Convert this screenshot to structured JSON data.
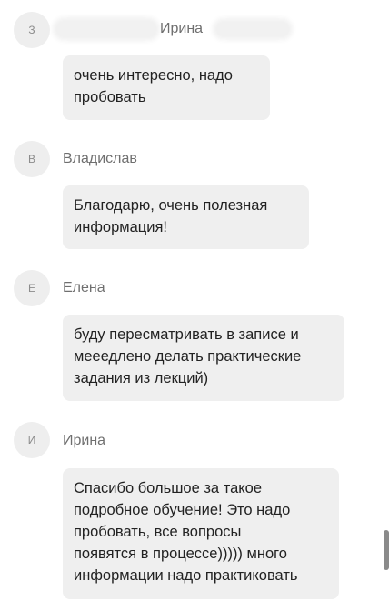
{
  "comments": [
    {
      "initial": "З",
      "author": "Ирина",
      "text": "очень интересно, надо\nпробовать"
    },
    {
      "initial": "В",
      "author": "Владислав",
      "text": "Благодарю, очень полезная\nинформация!"
    },
    {
      "initial": "Е",
      "author": "Елена",
      "text": "буду пересматривать в записе и\nмееедлено делать практические\nзадания из лекций)"
    },
    {
      "initial": "И",
      "author": "Ирина",
      "text": "Спасибо большое за такое\nподробное обучение! Это надо\nпробовать, все вопросы\nпоявятся в процессе))))) много\nинформации надо практиковать"
    }
  ]
}
